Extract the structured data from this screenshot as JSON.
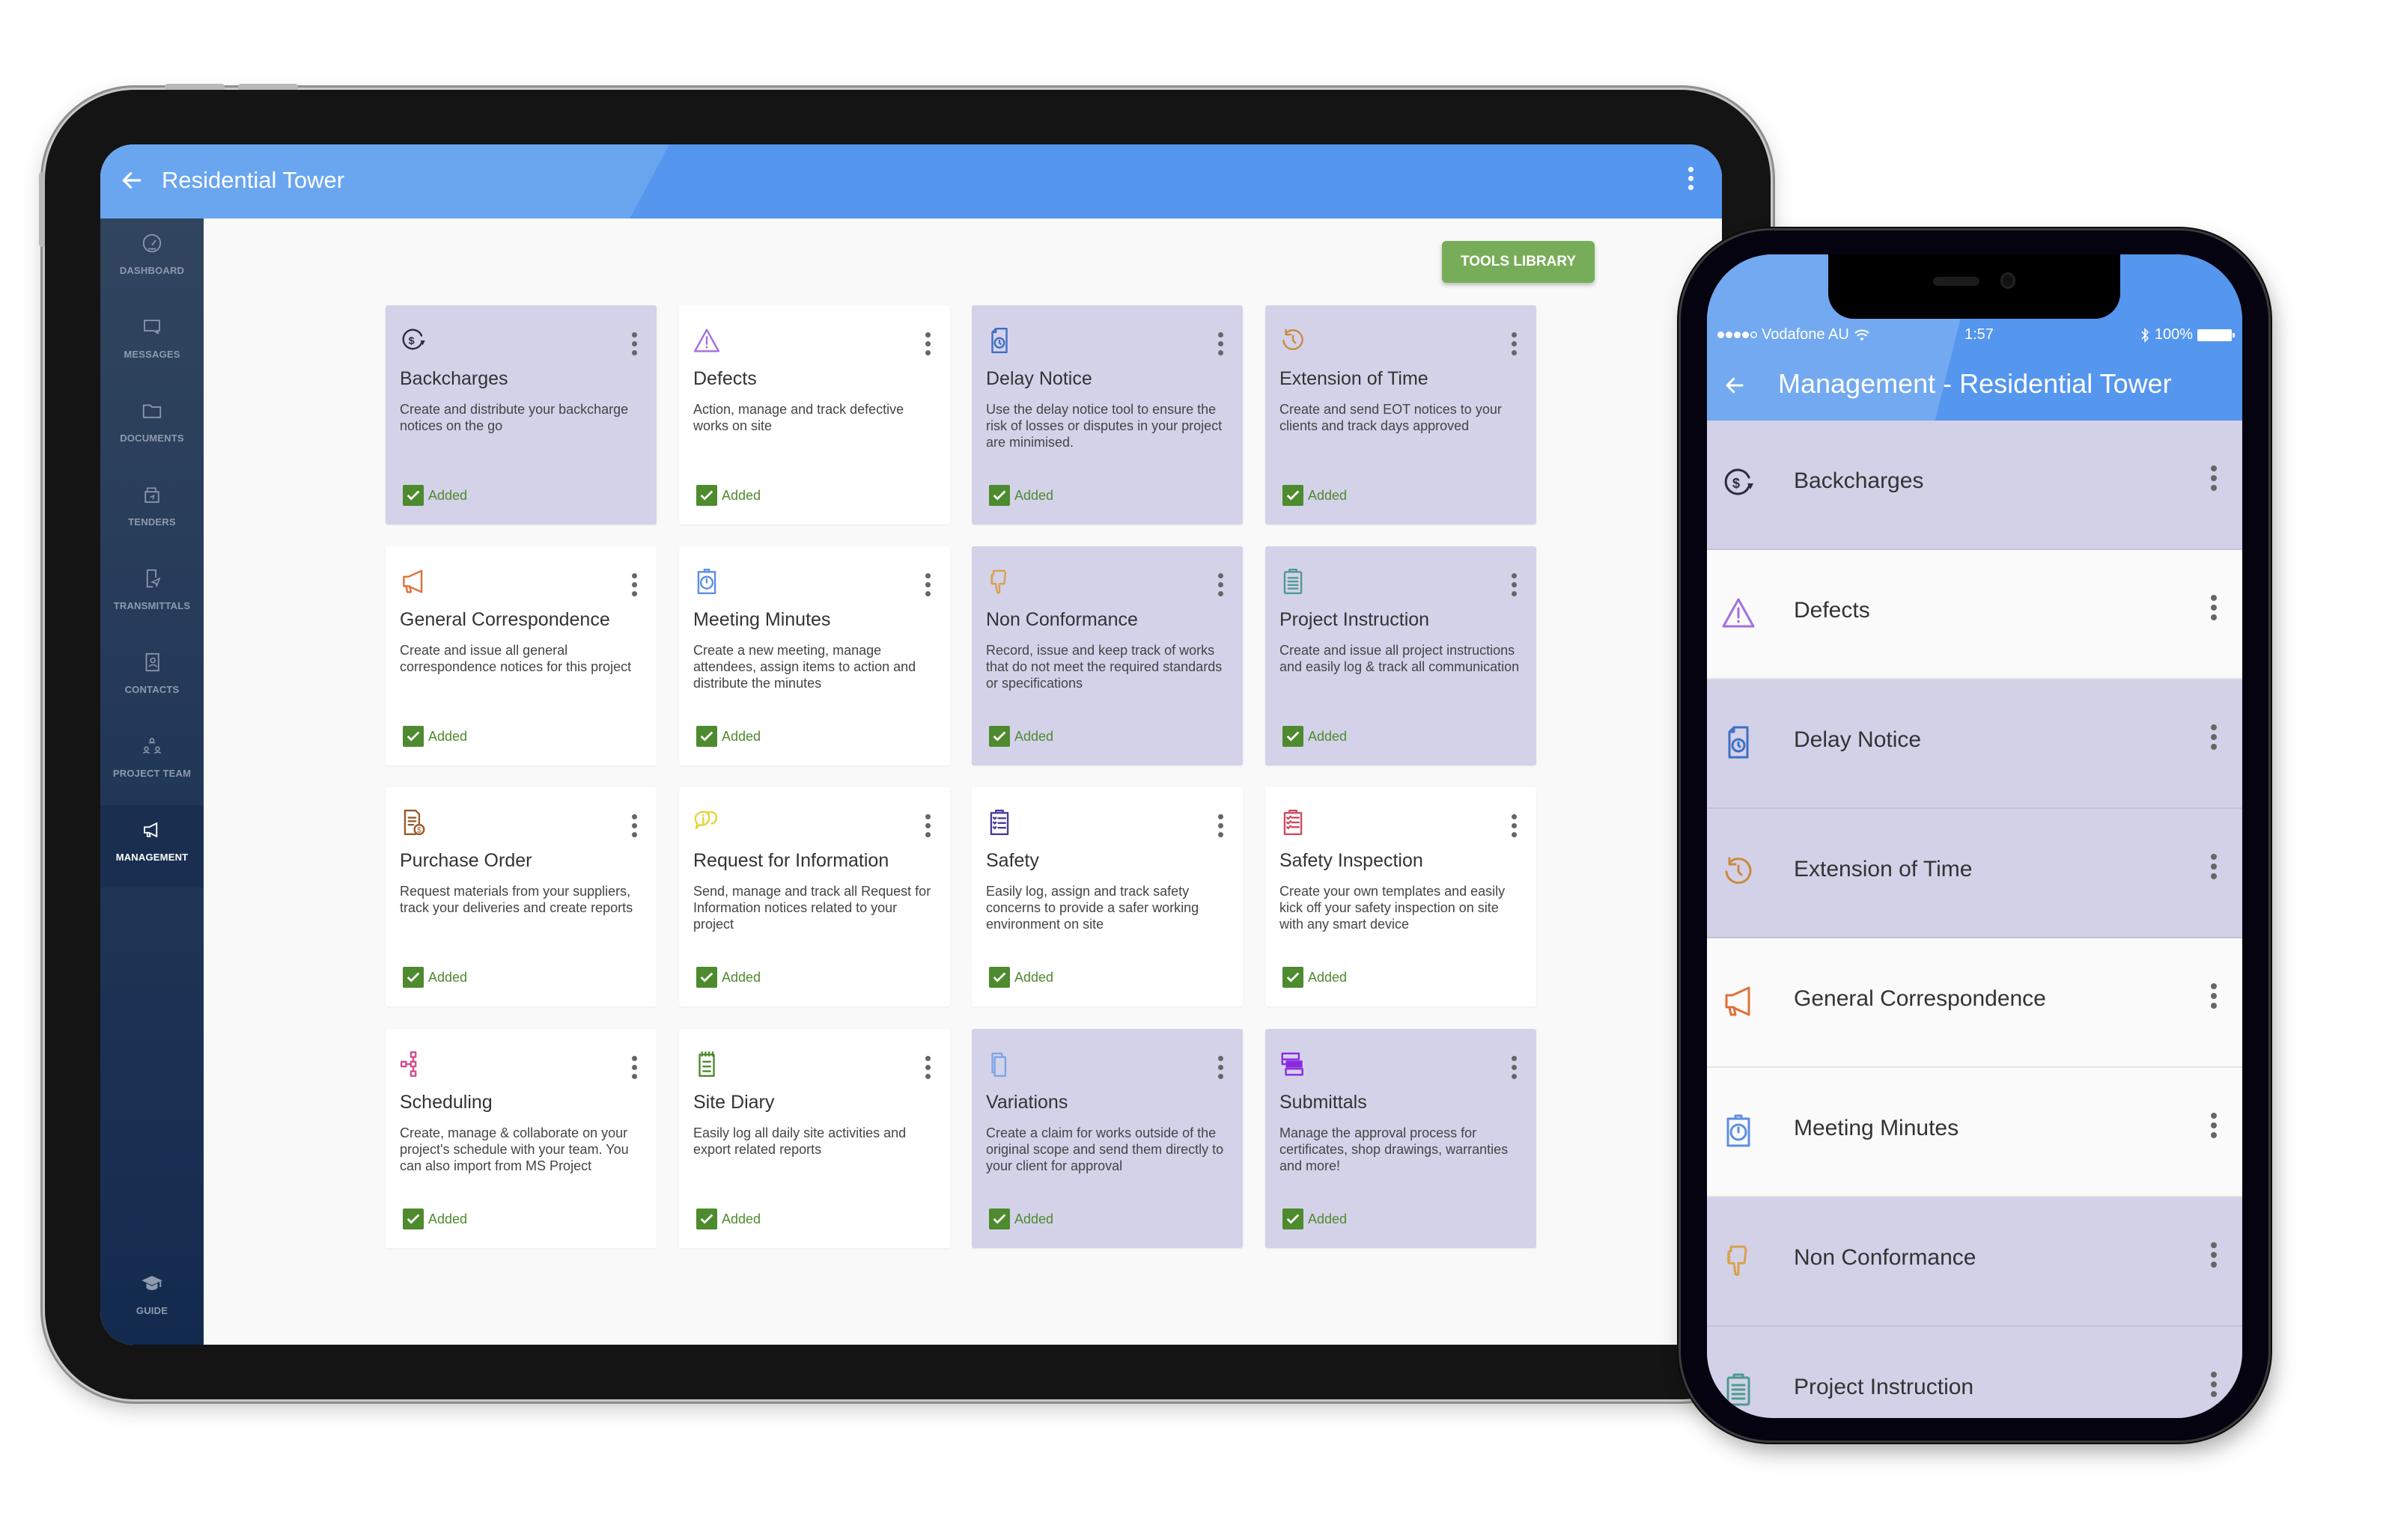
{
  "tablet": {
    "header": {
      "title": "Residential Tower",
      "back_icon": "arrow-left-icon",
      "menu_icon": "more-vertical-icon"
    },
    "sidebar": {
      "items": [
        {
          "label": "DASHBOARD",
          "icon": "speedometer-icon",
          "active": false
        },
        {
          "label": "MESSAGES",
          "icon": "chat-bubble-icon",
          "active": false
        },
        {
          "label": "DOCUMENTS",
          "icon": "folder-icon",
          "active": false
        },
        {
          "label": "TENDERS",
          "icon": "tender-box-icon",
          "active": false
        },
        {
          "label": "TRANSMITTALS",
          "icon": "document-send-icon",
          "active": false
        },
        {
          "label": "CONTACTS",
          "icon": "address-book-icon",
          "active": false
        },
        {
          "label": "PROJECT TEAM",
          "icon": "team-hierarchy-icon",
          "active": false
        },
        {
          "label": "MANAGEMENT",
          "icon": "megaphone-icon",
          "active": true
        }
      ],
      "guide": {
        "label": "GUIDE",
        "icon": "graduation-cap-icon"
      }
    },
    "tools_library_label": "TOOLS LIBRARY",
    "cards": [
      {
        "title": "Backcharges",
        "description": "Create and distribute your backcharge notices on the go",
        "status": "Added",
        "highlighted": true,
        "icon": "dollar-cycle-icon",
        "icon_color": "#2d2d3a"
      },
      {
        "title": "Defects",
        "description": "Action, manage and track defective works on site",
        "status": "Added",
        "highlighted": false,
        "icon": "warning-triangle-icon",
        "icon_color": "#a46ee0"
      },
      {
        "title": "Delay Notice",
        "description": "Use the delay notice tool to ensure the risk of losses or disputes in your project are minimised.",
        "status": "Added",
        "highlighted": true,
        "icon": "document-clock-icon",
        "icon_color": "#3f6fc4"
      },
      {
        "title": "Extension of Time",
        "description": "Create and send EOT notices to your clients and track days approved",
        "status": "Added",
        "highlighted": true,
        "icon": "clock-rewind-icon",
        "icon_color": "#c98a3c"
      },
      {
        "title": "General Correspondence",
        "description": "Create and issue all general correspondence notices for this project",
        "status": "Added",
        "highlighted": false,
        "icon": "megaphone-icon",
        "icon_color": "#e0703a"
      },
      {
        "title": "Meeting Minutes",
        "description": "Create a new meeting, manage attendees, assign items to action and distribute the minutes",
        "status": "Added",
        "highlighted": false,
        "icon": "stopwatch-icon",
        "icon_color": "#5b8fe0"
      },
      {
        "title": "Non Conformance",
        "description": "Record, issue and keep track of works that do not meet the required standards or specifications",
        "status": "Added",
        "highlighted": true,
        "icon": "thumbs-down-icon",
        "icon_color": "#d9a14a"
      },
      {
        "title": "Project Instruction",
        "description": "Create and issue all project instructions and easily log & track all communication",
        "status": "Added",
        "highlighted": true,
        "icon": "clipboard-icon",
        "icon_color": "#4f9a90"
      },
      {
        "title": "Purchase Order",
        "description": "Request materials from your suppliers, track your deliveries and create reports",
        "status": "Added",
        "highlighted": false,
        "icon": "invoice-dollar-icon",
        "icon_color": "#9a5a2a"
      },
      {
        "title": "Request for Information",
        "description": "Send, manage and track all Request for Information notices related to your project",
        "status": "Added",
        "highlighted": false,
        "icon": "info-chat-icon",
        "icon_color": "#e6d43a"
      },
      {
        "title": "Safety",
        "description": "Easily log, assign and track safety concerns to provide a safer working environment on site",
        "status": "Added",
        "highlighted": false,
        "icon": "checklist-clipboard-icon",
        "icon_color": "#4a3a9a"
      },
      {
        "title": "Safety Inspection",
        "description": "Create your own templates and easily kick off your safety inspection on site with any smart device",
        "status": "Added",
        "highlighted": false,
        "icon": "inspection-clipboard-icon",
        "icon_color": "#d04a60"
      },
      {
        "title": "Scheduling",
        "description": "Create, manage & collaborate on your project's schedule with your team. You can also import from MS Project",
        "status": "Added",
        "highlighted": false,
        "icon": "schedule-tree-icon",
        "icon_color": "#d0508a"
      },
      {
        "title": "Site Diary",
        "description": "Easily log all daily site activities and export related reports",
        "status": "Added",
        "highlighted": false,
        "icon": "notepad-icon",
        "icon_color": "#4e8a2e"
      },
      {
        "title": "Variations",
        "description": "Create a claim for works outside of the original scope and send them directly to your client for approval",
        "status": "Added",
        "highlighted": true,
        "icon": "documents-stack-icon",
        "icon_color": "#7aa6e8"
      },
      {
        "title": "Submittals",
        "description": "Manage the approval process for certificates, shop drawings, warranties and more!",
        "status": "Added",
        "highlighted": true,
        "icon": "submittal-layers-icon",
        "icon_color": "#8a2ae0"
      }
    ]
  },
  "phone": {
    "status_bar": {
      "carrier": "Vodafone AU",
      "signal_bars": 4,
      "signal_max": 5,
      "time": "1:57",
      "battery": "100%"
    },
    "header": {
      "title": "Management - Residential Tower",
      "back_icon": "arrow-left-icon"
    },
    "items": [
      {
        "label": "Backcharges",
        "icon": "dollar-cycle-icon",
        "highlighted": true
      },
      {
        "label": "Defects",
        "icon": "warning-triangle-icon",
        "highlighted": false
      },
      {
        "label": "Delay Notice",
        "icon": "document-clock-icon",
        "highlighted": true
      },
      {
        "label": "Extension of Time",
        "icon": "clock-rewind-icon",
        "highlighted": true
      },
      {
        "label": "General Correspondence",
        "icon": "megaphone-icon",
        "highlighted": false
      },
      {
        "label": "Meeting Minutes",
        "icon": "stopwatch-icon",
        "highlighted": false
      },
      {
        "label": "Non Conformance",
        "icon": "thumbs-down-icon",
        "highlighted": true
      },
      {
        "label": "Project Instruction",
        "icon": "clipboard-icon",
        "highlighted": true
      }
    ],
    "fab_icon": "apps-grid-icon"
  },
  "colors": {
    "header_blue": "#5596ee",
    "sidebar_navy": "#132a4f",
    "highlight_lavender": "#d4d2e9",
    "added_green": "#4e8a2e",
    "button_green": "#77ad58"
  }
}
